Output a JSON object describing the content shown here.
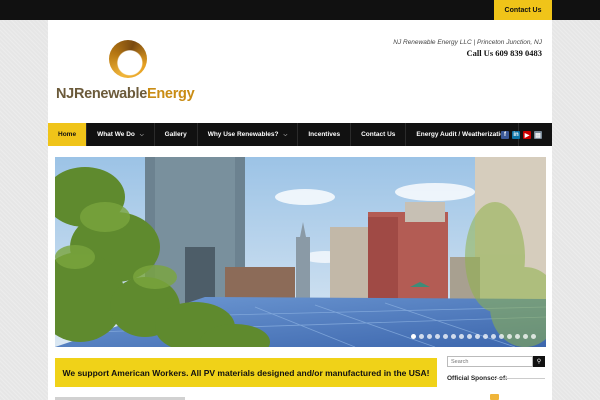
{
  "topbar": {
    "contact_label": "Contact Us"
  },
  "header": {
    "logo": {
      "part1": "NJ",
      "part2": "Renewable",
      "part3": "Energy"
    },
    "tagline": "NJ Renewable Energy LLC | Princeton Junction, NJ",
    "phone": "Call Us 609 839 0483"
  },
  "nav": {
    "items": [
      {
        "label": "Home",
        "active": true,
        "caret": ""
      },
      {
        "label": "What We Do",
        "active": false,
        "caret": "v"
      },
      {
        "label": "Gallery",
        "active": false,
        "caret": ""
      },
      {
        "label": "Why Use Renewables?",
        "active": false,
        "caret": "v"
      },
      {
        "label": "Incentives",
        "active": false,
        "caret": ""
      },
      {
        "label": "Contact Us",
        "active": false,
        "caret": ""
      },
      {
        "label": "Energy Audit / Weatherization",
        "active": false,
        "caret": ""
      }
    ],
    "social": [
      {
        "icon": "facebook-icon",
        "glyph": "f",
        "color": "#3b5998"
      },
      {
        "icon": "linkedin-icon",
        "glyph": "in",
        "color": "#0e76a8"
      },
      {
        "icon": "youtube-icon",
        "glyph": "▶",
        "color": "#cc0000"
      },
      {
        "icon": "contact-card-icon",
        "glyph": "▤",
        "color": "#7a8a99"
      }
    ]
  },
  "slider": {
    "slide_count": 16,
    "active_slide": 0
  },
  "banner": {
    "text": "We support American Workers. All PV materials designed and/or manufactured in the USA!"
  },
  "sidebar": {
    "search_placeholder": "Search",
    "search_icon": "search-icon",
    "sponsor_heading": "Official Sponsor of:"
  },
  "colors": {
    "accent": "#f0c419",
    "nav_bg": "#111111",
    "banner_bg": "#f0d218"
  }
}
